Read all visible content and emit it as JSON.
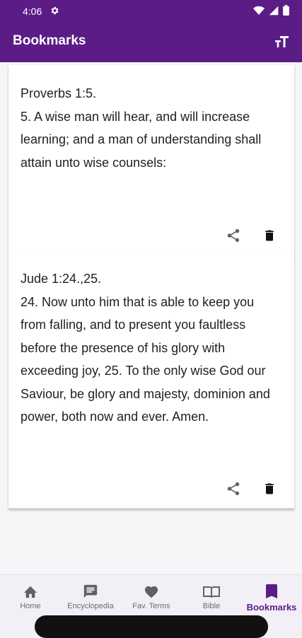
{
  "status": {
    "time": "4:06"
  },
  "app": {
    "title": "Bookmarks"
  },
  "bookmarks": [
    {
      "reference": "Proverbs 1:5.",
      "text": "5. A wise man will hear, and will increase learning; and a man of understanding shall attain unto wise counsels:"
    },
    {
      "reference": "Jude 1:24.,25.",
      "text": "24. Now unto him that is able to keep you from falling, and to present you faultless before the presence of his glory with exceeding joy, 25. To the only wise God our Saviour, be glory and majesty, dominion and power, both now and ever. Amen."
    }
  ],
  "nav": {
    "items": [
      {
        "label": "Home",
        "icon": "home-icon"
      },
      {
        "label": "Encyclopedia",
        "icon": "chat-icon"
      },
      {
        "label": "Fav. Terms",
        "icon": "heart-icon"
      },
      {
        "label": "Bible",
        "icon": "book-icon"
      },
      {
        "label": "Bookmarks",
        "icon": "bookmark-icon",
        "active": true
      }
    ]
  },
  "colors": {
    "primary": "#5b1c86",
    "background": "#f6f5f7",
    "nav_background": "#f3eff6"
  }
}
